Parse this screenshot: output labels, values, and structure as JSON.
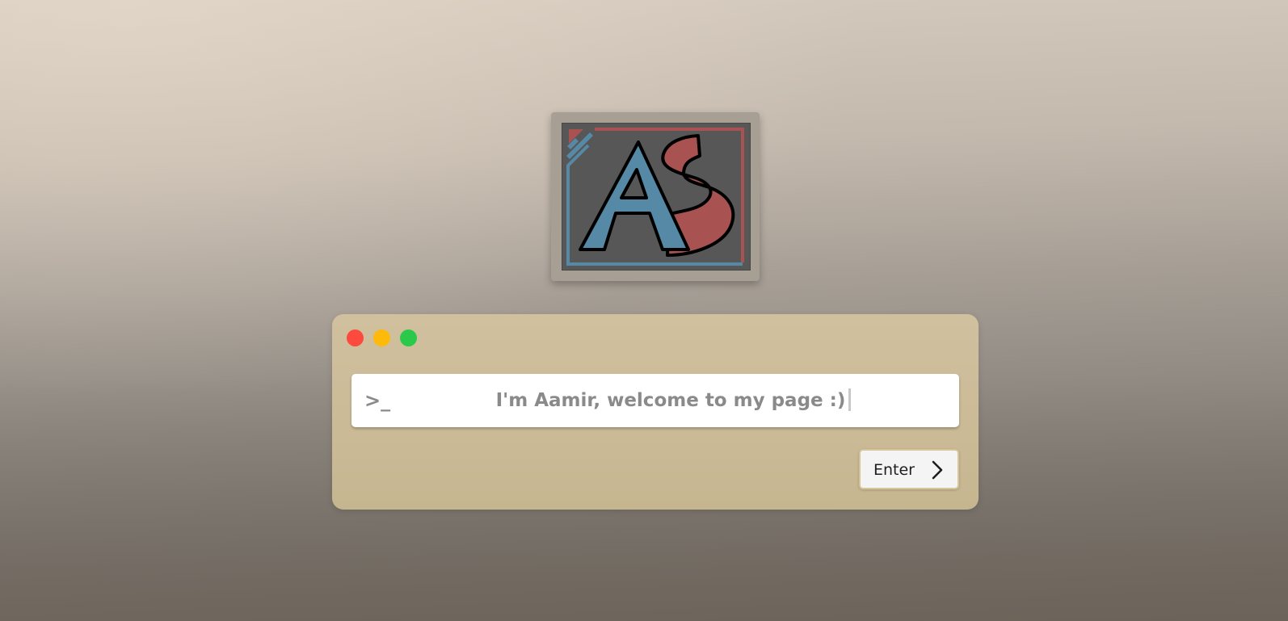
{
  "page": {
    "background_top": "#d6cbbf",
    "background_bottom": "#6f685f"
  },
  "logo": {
    "icon": "as-monogram-logo",
    "letters": "AS",
    "colors": {
      "frame": "#a79f94",
      "panel": "#575757",
      "blue": "#5589a6",
      "red": "#a85352",
      "outline": "#000000"
    }
  },
  "terminal": {
    "background": "#cdbd99",
    "window_controls": [
      {
        "name": "close",
        "color": "#fc4a3f"
      },
      {
        "name": "minimize",
        "color": "#fdba0b"
      },
      {
        "name": "maximize",
        "color": "#2bc94a"
      }
    ],
    "prompt_symbol": ">_",
    "input_text": "I'm Aamir, welcome to my page :)",
    "enter_label": "Enter",
    "enter_icon": "chevron-right-icon"
  }
}
